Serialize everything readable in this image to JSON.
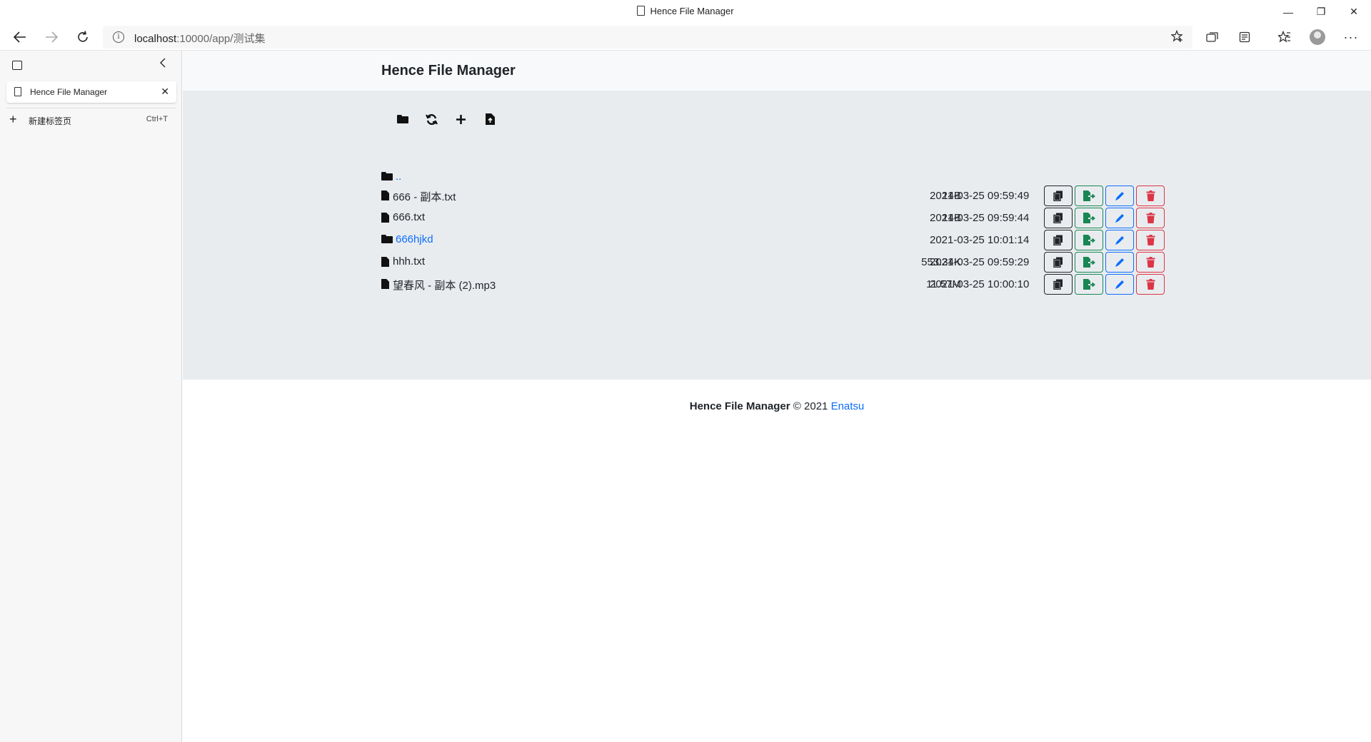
{
  "window": {
    "title": "Hence File Manager",
    "controls": {
      "minimize": "—",
      "restore": "❐",
      "close": "✕"
    }
  },
  "browser": {
    "url_host": "localhost",
    "url_rest": ":10000/app/测试集",
    "info_glyph": "i"
  },
  "sidebar": {
    "tabs": [
      {
        "label": "Hence File Manager",
        "close": "✕"
      }
    ],
    "new_tab": {
      "plus": "+",
      "label": "新建标签页",
      "shortcut": "Ctrl+T"
    }
  },
  "page": {
    "brand": "Hence File Manager",
    "parent_dir": "..",
    "files": [
      {
        "type": "file",
        "name": "666 - 副本.txt",
        "size": "14B",
        "date": "2021-03-25 09:59:49"
      },
      {
        "type": "file",
        "name": "666.txt",
        "size": "14B",
        "date": "2021-03-25 09:59:44"
      },
      {
        "type": "folder",
        "name": "666hjkd",
        "size": "",
        "date": "2021-03-25 10:01:14"
      },
      {
        "type": "file",
        "name": "hhh.txt",
        "size": "553.34K",
        "date": "2021-03-25 09:59:29"
      },
      {
        "type": "file",
        "name": "望春风 - 副本 (2).mp3",
        "size": "11.57M",
        "date": "2021-03-25 10:00:10"
      }
    ],
    "footer": {
      "brand": "Hence File Manager",
      "copy": " © 2021 ",
      "author": "Enatsu"
    }
  },
  "colors": {
    "dark": "#212529",
    "green": "#198754",
    "blue": "#0d6efd",
    "red": "#dc3545",
    "main_bg": "#e9ecef"
  },
  "icons": {
    "toolbar": [
      "folder-open-icon",
      "refresh-icon",
      "plus-icon",
      "upload-file-icon"
    ],
    "row_buttons": [
      "copy-icon",
      "move-icon",
      "edit-icon",
      "trash-icon"
    ]
  }
}
